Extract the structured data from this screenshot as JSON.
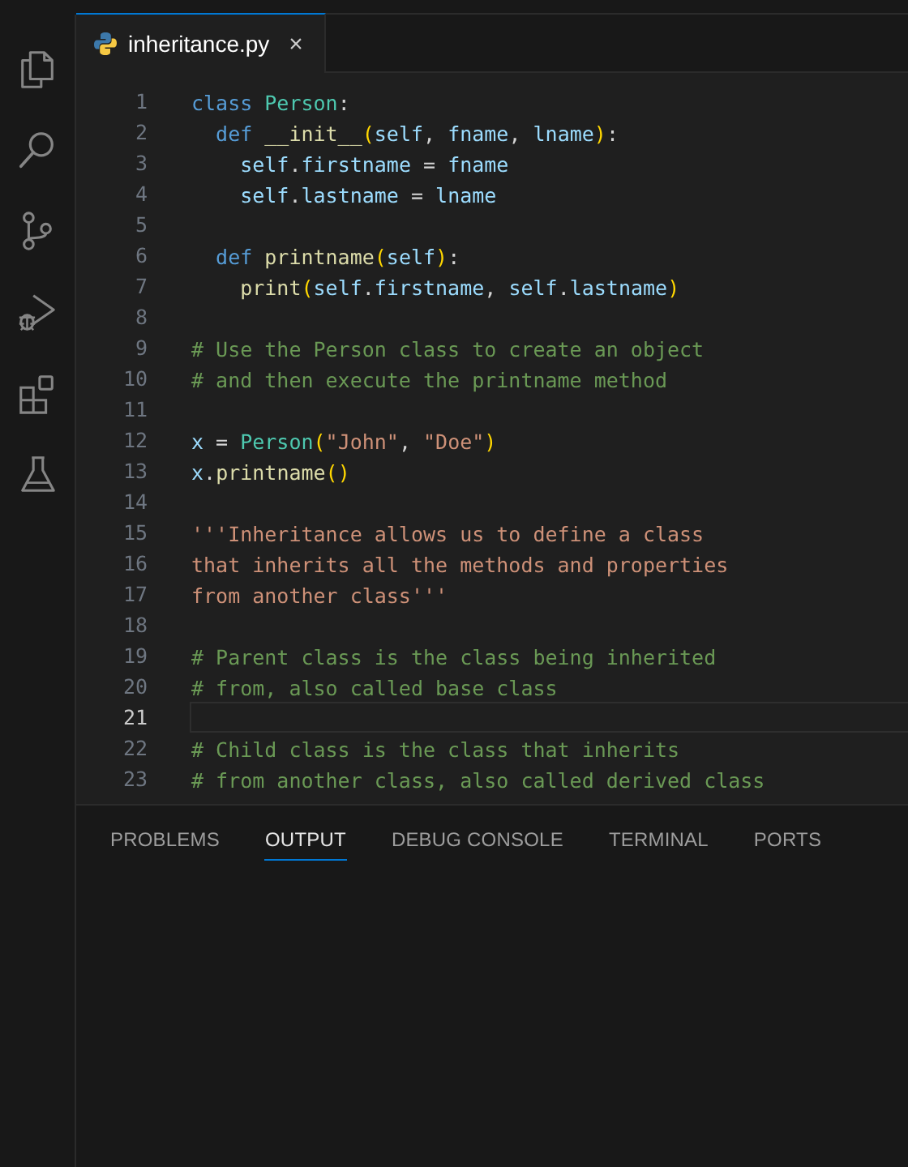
{
  "activity_bar": {
    "items": [
      {
        "kind": "explorer",
        "selected": false
      },
      {
        "kind": "search",
        "selected": false
      },
      {
        "kind": "source-control",
        "selected": false
      },
      {
        "kind": "run-debug",
        "selected": false
      },
      {
        "kind": "extensions",
        "selected": false
      },
      {
        "kind": "testing",
        "selected": false
      }
    ]
  },
  "tabs": [
    {
      "label": "inheritance.py",
      "close": "×",
      "selected": true
    }
  ],
  "editor": {
    "lines": [
      {
        "number": "1",
        "current": false,
        "tokens": [
          {
            "kind": "keyword",
            "text": "class "
          },
          {
            "kind": "class",
            "text": "Person"
          },
          {
            "kind": "punct",
            "text": ":"
          }
        ]
      },
      {
        "number": "2",
        "current": false,
        "tokens": [
          {
            "kind": "keyword",
            "text": "  def "
          },
          {
            "kind": "function",
            "text": "__init__"
          },
          {
            "kind": "paren",
            "text": "("
          },
          {
            "kind": "variable",
            "text": "self"
          },
          {
            "kind": "punct",
            "text": ", "
          },
          {
            "kind": "variable",
            "text": "fname"
          },
          {
            "kind": "punct",
            "text": ", "
          },
          {
            "kind": "variable",
            "text": "lname"
          },
          {
            "kind": "paren",
            "text": ")"
          },
          {
            "kind": "punct",
            "text": ":"
          }
        ]
      },
      {
        "number": "3",
        "current": false,
        "tokens": [
          {
            "kind": "variable",
            "text": "    self"
          },
          {
            "kind": "punct",
            "text": "."
          },
          {
            "kind": "variable",
            "text": "firstname"
          },
          {
            "kind": "punct",
            "text": " = "
          },
          {
            "kind": "variable",
            "text": "fname"
          }
        ]
      },
      {
        "number": "4",
        "current": false,
        "tokens": [
          {
            "kind": "variable",
            "text": "    self"
          },
          {
            "kind": "punct",
            "text": "."
          },
          {
            "kind": "variable",
            "text": "lastname"
          },
          {
            "kind": "punct",
            "text": " = "
          },
          {
            "kind": "variable",
            "text": "lname"
          }
        ]
      },
      {
        "number": "5",
        "current": false
      },
      {
        "number": "6",
        "current": false,
        "tokens": [
          {
            "kind": "keyword",
            "text": "  def "
          },
          {
            "kind": "function",
            "text": "printname"
          },
          {
            "kind": "paren",
            "text": "("
          },
          {
            "kind": "variable",
            "text": "self"
          },
          {
            "kind": "paren",
            "text": ")"
          },
          {
            "kind": "punct",
            "text": ":"
          }
        ]
      },
      {
        "number": "7",
        "current": false,
        "tokens": [
          {
            "kind": "function",
            "text": "    print"
          },
          {
            "kind": "paren",
            "text": "("
          },
          {
            "kind": "variable",
            "text": "self"
          },
          {
            "kind": "punct",
            "text": "."
          },
          {
            "kind": "variable",
            "text": "firstname"
          },
          {
            "kind": "punct",
            "text": ", "
          },
          {
            "kind": "variable",
            "text": "self"
          },
          {
            "kind": "punct",
            "text": "."
          },
          {
            "kind": "variable",
            "text": "lastname"
          },
          {
            "kind": "paren",
            "text": ")"
          }
        ]
      },
      {
        "number": "8",
        "current": false
      },
      {
        "number": "9",
        "current": false,
        "tokens": [
          {
            "kind": "comment",
            "text": "# Use the Person class to create an object"
          }
        ]
      },
      {
        "number": "10",
        "current": false,
        "tokens": [
          {
            "kind": "comment",
            "text": "# and then execute the printname method"
          }
        ]
      },
      {
        "number": "11",
        "current": false
      },
      {
        "number": "12",
        "current": false,
        "tokens": [
          {
            "kind": "variable",
            "text": "x"
          },
          {
            "kind": "punct",
            "text": " = "
          },
          {
            "kind": "class",
            "text": "Person"
          },
          {
            "kind": "paren",
            "text": "("
          },
          {
            "kind": "string",
            "text": "\"John\""
          },
          {
            "kind": "punct",
            "text": ", "
          },
          {
            "kind": "string",
            "text": "\"Doe\""
          },
          {
            "kind": "paren",
            "text": ")"
          }
        ]
      },
      {
        "number": "13",
        "current": false,
        "tokens": [
          {
            "kind": "variable",
            "text": "x"
          },
          {
            "kind": "punct",
            "text": "."
          },
          {
            "kind": "function",
            "text": "printname"
          },
          {
            "kind": "paren",
            "text": "()"
          }
        ]
      },
      {
        "number": "14",
        "current": false
      },
      {
        "number": "15",
        "current": false,
        "tokens": [
          {
            "kind": "string",
            "text": "'''Inheritance allows us to define a class"
          }
        ]
      },
      {
        "number": "16",
        "current": false,
        "tokens": [
          {
            "kind": "string",
            "text": "that inherits all the methods and properties"
          }
        ]
      },
      {
        "number": "17",
        "current": false,
        "tokens": [
          {
            "kind": "string",
            "text": "from another class'''"
          }
        ]
      },
      {
        "number": "18",
        "current": false
      },
      {
        "number": "19",
        "current": false,
        "tokens": [
          {
            "kind": "comment",
            "text": "# Parent class is the class being inherited"
          }
        ]
      },
      {
        "number": "20",
        "current": false,
        "tokens": [
          {
            "kind": "comment",
            "text": "# from, also called base class"
          }
        ]
      },
      {
        "number": "21",
        "current": true
      },
      {
        "number": "22",
        "current": false,
        "tokens": [
          {
            "kind": "comment",
            "text": "# Child class is the class that inherits"
          }
        ]
      },
      {
        "number": "23",
        "current": false,
        "tokens": [
          {
            "kind": "comment",
            "text": "# from another class, also called derived class"
          }
        ]
      }
    ]
  },
  "panel": {
    "tabs": [
      {
        "label": "PROBLEMS",
        "selected": false
      },
      {
        "label": "OUTPUT",
        "selected": true
      },
      {
        "label": "DEBUG CONSOLE",
        "selected": false
      },
      {
        "label": "TERMINAL",
        "selected": false
      },
      {
        "label": "PORTS",
        "selected": false
      }
    ]
  }
}
